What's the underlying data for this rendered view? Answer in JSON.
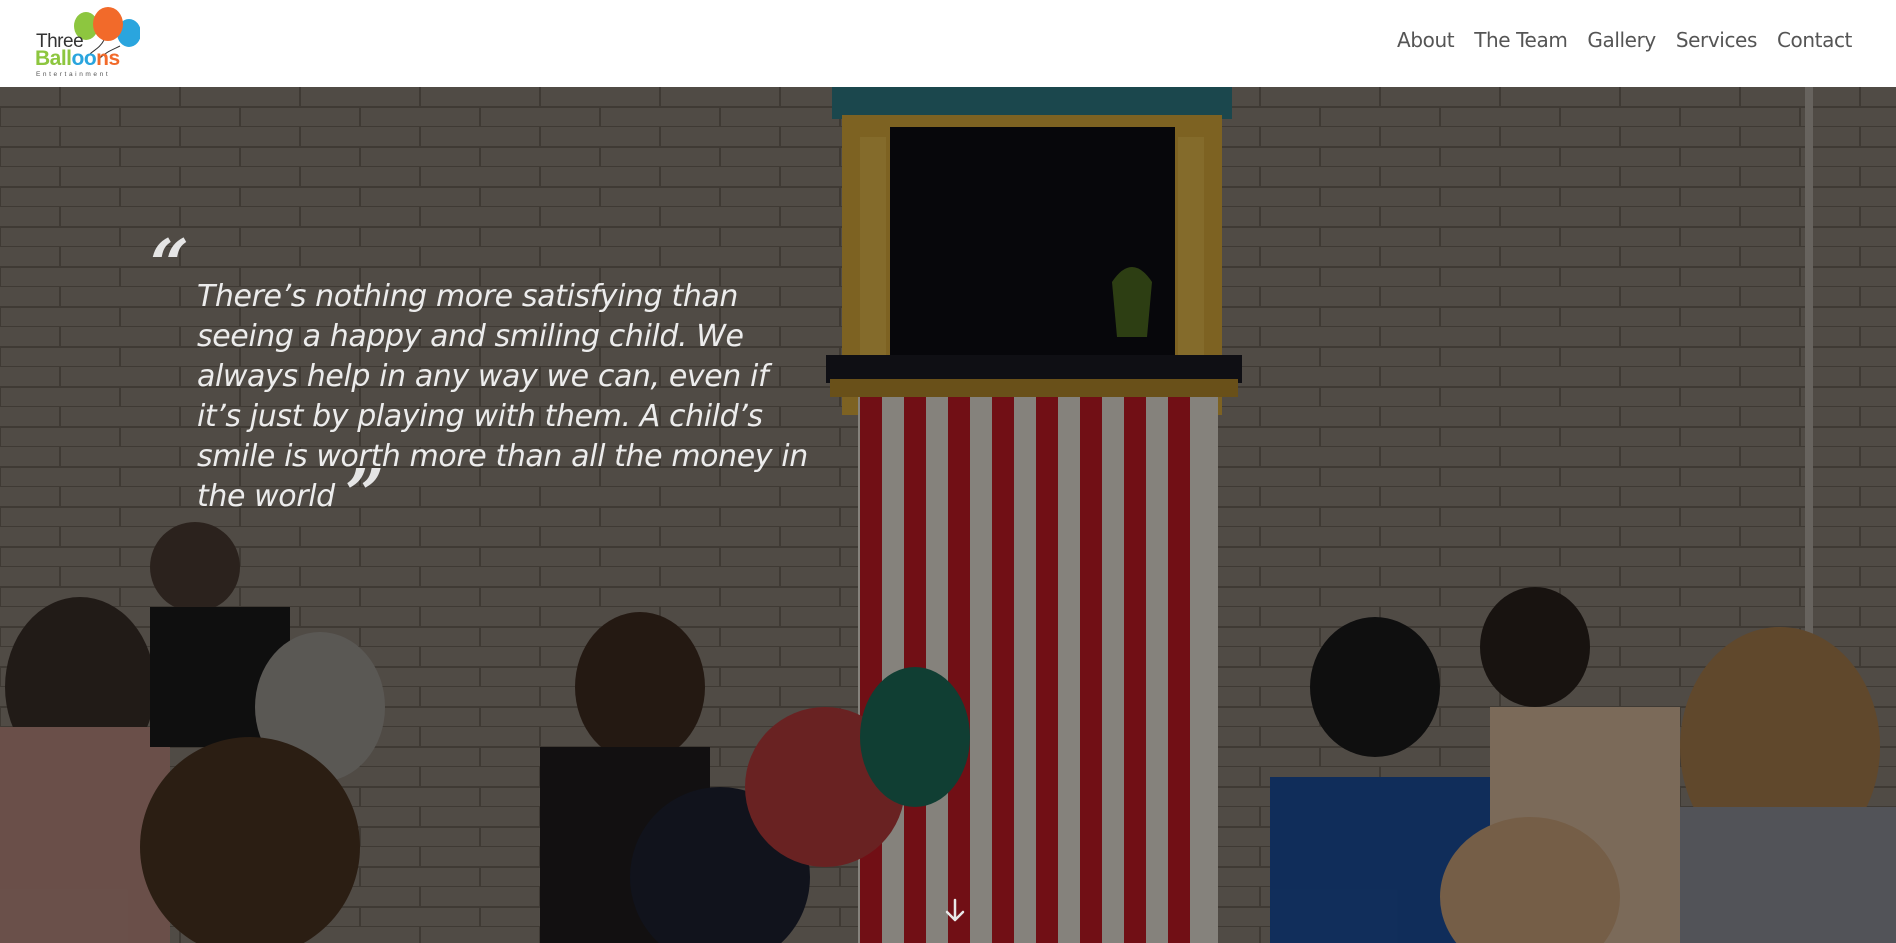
{
  "brand": {
    "line1": "Three",
    "line2": "Balloons",
    "line3": "Entertainment",
    "colors": {
      "orange": "#f26a2a",
      "green": "#8dc63f",
      "blue": "#2aa5de",
      "text": "#333333"
    }
  },
  "nav": {
    "items": [
      {
        "label": "About"
      },
      {
        "label": "The Team"
      },
      {
        "label": "Gallery"
      },
      {
        "label": "Services"
      },
      {
        "label": "Contact"
      }
    ]
  },
  "hero": {
    "quote_open": "“",
    "quote_text": "There’s nothing more satisfying than seeing a happy and smiling child. We always help in any way we can, even if it’s just by playing with them. A child’s smile is worth more than all the money in the world",
    "quote_close": "”",
    "scroll_icon": "arrow-down-icon"
  }
}
